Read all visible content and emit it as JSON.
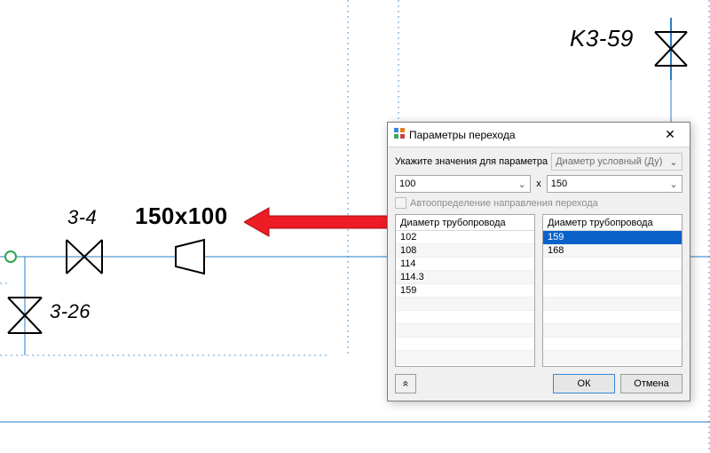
{
  "schematic": {
    "label_top_left": "3-4",
    "label_big": "150x100",
    "label_bottom_left": "3-26",
    "label_top_right": "K3-59"
  },
  "dialog": {
    "title": "Параметры перехода",
    "param_label": "Укажите значения для параметра",
    "param_combo": "Диаметр условный (Ду)",
    "left_value": "100",
    "separator": "x",
    "right_value": "150",
    "auto_detect_label": "Автоопределение направления перехода",
    "left_header": "Диаметр трубопровода",
    "right_header": "Диаметр трубопровода",
    "left_items": [
      "102",
      "108",
      "114",
      "114.3",
      "159"
    ],
    "right_items": [
      "159",
      "168"
    ],
    "right_selected_index": 0,
    "ok_label": "ОК",
    "cancel_label": "Отмена",
    "expand_glyph": "«"
  },
  "icons": {
    "close": "✕",
    "dropdown": "⌄"
  }
}
